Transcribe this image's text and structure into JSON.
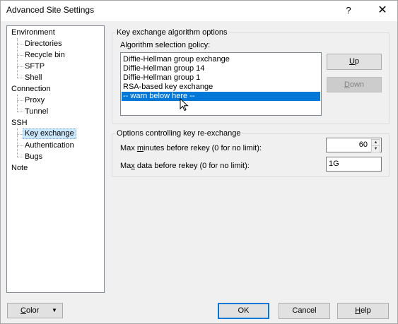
{
  "window": {
    "title": "Advanced Site Settings",
    "help_glyph": "?",
    "close_glyph": "✕"
  },
  "tree": {
    "items": [
      {
        "label": "Environment"
      },
      {
        "label": "Directories"
      },
      {
        "label": "Recycle bin"
      },
      {
        "label": "SFTP"
      },
      {
        "label": "Shell"
      },
      {
        "label": "Connection"
      },
      {
        "label": "Proxy"
      },
      {
        "label": "Tunnel"
      },
      {
        "label": "SSH"
      },
      {
        "label": "Key exchange",
        "selected": true
      },
      {
        "label": "Authentication"
      },
      {
        "label": "Bugs"
      },
      {
        "label": "Note"
      }
    ]
  },
  "kex_options": {
    "group_title": "Key exchange algorithm options",
    "policy_label": {
      "pre": "Algorithm selection ",
      "key": "p",
      "post": "olicy:"
    },
    "algorithms": [
      {
        "label": "Diffie-Hellman group exchange"
      },
      {
        "label": "Diffie-Hellman group 14"
      },
      {
        "label": "Diffie-Hellman group 1"
      },
      {
        "label": "RSA-based key exchange"
      },
      {
        "label": "-- warn below here --",
        "selected": true
      }
    ],
    "up_button": {
      "key": "U",
      "rest": "p"
    },
    "down_button": {
      "key": "D",
      "rest": "own"
    }
  },
  "rekey_options": {
    "group_title": "Options controlling key re-exchange",
    "max_minutes_label": {
      "pre": "Max ",
      "key": "m",
      "post": "inutes before rekey (0 for no limit):"
    },
    "max_minutes_value": "60",
    "max_data_label": {
      "pre": "Ma",
      "key": "x",
      "post": " data before rekey (0 for no limit):"
    },
    "max_data_value": "1G"
  },
  "footer": {
    "color_button": {
      "key": "C",
      "rest": "olor"
    },
    "ok_label": "OK",
    "cancel_label": "Cancel",
    "help_button": {
      "key": "H",
      "rest": "elp"
    }
  },
  "colors": {
    "selection": "#0078d7",
    "tree_selection": "#cce8ff",
    "window_bg": "#f0f0f0"
  }
}
